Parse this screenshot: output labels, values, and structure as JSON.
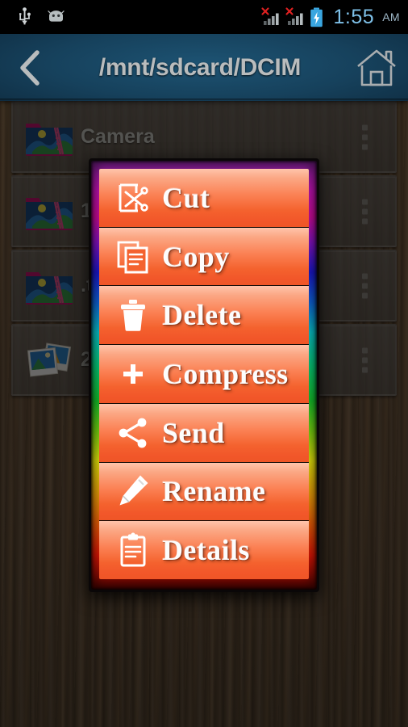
{
  "statusbar": {
    "left_icons": [
      "usb-icon",
      "android-robot-icon"
    ],
    "right_icons": [
      "signal-no-sim-1-icon",
      "signal-no-sim-2-icon",
      "battery-charging-icon"
    ],
    "time": "1:55",
    "ampm": "AM",
    "time_color": "#7ec0e8",
    "background": "#000000"
  },
  "header": {
    "back_icon": "chevron-left-icon",
    "title": "/mnt/sdcard/DCIM",
    "home_icon": "home-icon",
    "title_color": "#b9bcbd",
    "background": "#16415c"
  },
  "file_list": {
    "rows": [
      {
        "label": "Camera",
        "icon": "folder-image-icon",
        "overflow": "more-vertical-icon"
      },
      {
        "label": "100",
        "icon": "folder-image-icon",
        "overflow": "more-vertical-icon"
      },
      {
        "label": ".thu",
        "icon": "folder-image-icon",
        "overflow": "more-vertical-icon"
      },
      {
        "label": "201",
        "icon": "photos-stack-icon",
        "overflow": "more-vertical-icon"
      }
    ]
  },
  "dialog": {
    "border_style": "rainbow-gradient",
    "border_colors": [
      "#c312b5",
      "#1c18d6",
      "#09c8d0",
      "#16c92c",
      "#ecea0a",
      "#f4a008",
      "#e31605"
    ],
    "item_color": "#f4622e",
    "items": [
      {
        "label": "Cut",
        "icon": "cut-icon"
      },
      {
        "label": "Copy",
        "icon": "copy-icon"
      },
      {
        "label": "Delete",
        "icon": "trash-icon"
      },
      {
        "label": "Compress",
        "icon": "compress-arrows-icon"
      },
      {
        "label": "Send",
        "icon": "share-icon"
      },
      {
        "label": "Rename",
        "icon": "pencil-icon"
      },
      {
        "label": "Details",
        "icon": "clipboard-icon"
      }
    ]
  }
}
